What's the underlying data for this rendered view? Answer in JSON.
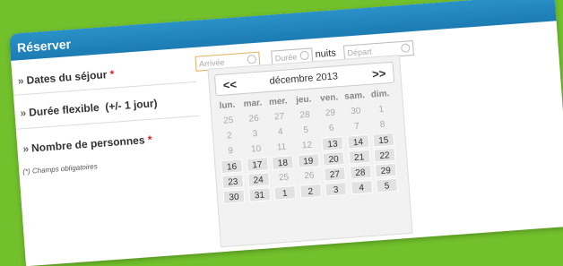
{
  "header": {
    "title": "Réserver"
  },
  "form": {
    "dates_label": "Dates du séjour",
    "flex_label": "Durée flexible",
    "flex_hint": "(+/- 1 jour)",
    "persons_label": "Nombre de personnes",
    "required_mark": "*",
    "required_note": "(*) Champs obligatoires",
    "arrivee_placeholder": "Arrivée",
    "duree_placeholder": "Durée",
    "nuits_label": "nuits",
    "depart_placeholder": "Départ"
  },
  "calendar": {
    "prev": "<<",
    "next": ">>",
    "month": "décembre 2013",
    "days_of_week": [
      "lun.",
      "mar.",
      "mer.",
      "jeu.",
      "ven.",
      "sam.",
      "dim."
    ],
    "weeks": [
      [
        {
          "d": "25",
          "a": false
        },
        {
          "d": "26",
          "a": false
        },
        {
          "d": "27",
          "a": false
        },
        {
          "d": "28",
          "a": false
        },
        {
          "d": "29",
          "a": false
        },
        {
          "d": "30",
          "a": false
        },
        {
          "d": "1",
          "a": false
        }
      ],
      [
        {
          "d": "2",
          "a": false
        },
        {
          "d": "3",
          "a": false
        },
        {
          "d": "4",
          "a": false
        },
        {
          "d": "5",
          "a": false
        },
        {
          "d": "6",
          "a": false
        },
        {
          "d": "7",
          "a": false
        },
        {
          "d": "8",
          "a": false
        }
      ],
      [
        {
          "d": "9",
          "a": false
        },
        {
          "d": "10",
          "a": false
        },
        {
          "d": "11",
          "a": false
        },
        {
          "d": "12",
          "a": false
        },
        {
          "d": "13",
          "a": true
        },
        {
          "d": "14",
          "a": true
        },
        {
          "d": "15",
          "a": true
        }
      ],
      [
        {
          "d": "16",
          "a": true
        },
        {
          "d": "17",
          "a": true
        },
        {
          "d": "18",
          "a": true
        },
        {
          "d": "19",
          "a": true
        },
        {
          "d": "20",
          "a": true
        },
        {
          "d": "21",
          "a": true
        },
        {
          "d": "22",
          "a": true
        }
      ],
      [
        {
          "d": "23",
          "a": true
        },
        {
          "d": "24",
          "a": true
        },
        {
          "d": "25",
          "a": false
        },
        {
          "d": "26",
          "a": false
        },
        {
          "d": "27",
          "a": true
        },
        {
          "d": "28",
          "a": true
        },
        {
          "d": "29",
          "a": true
        }
      ],
      [
        {
          "d": "30",
          "a": true
        },
        {
          "d": "31",
          "a": true
        },
        {
          "d": "1",
          "a": true
        },
        {
          "d": "2",
          "a": true
        },
        {
          "d": "3",
          "a": true
        },
        {
          "d": "4",
          "a": true
        },
        {
          "d": "5",
          "a": true
        }
      ]
    ]
  },
  "colors": {
    "background": "#72c02c",
    "header": "#1c7bb3",
    "required": "#e02020"
  }
}
